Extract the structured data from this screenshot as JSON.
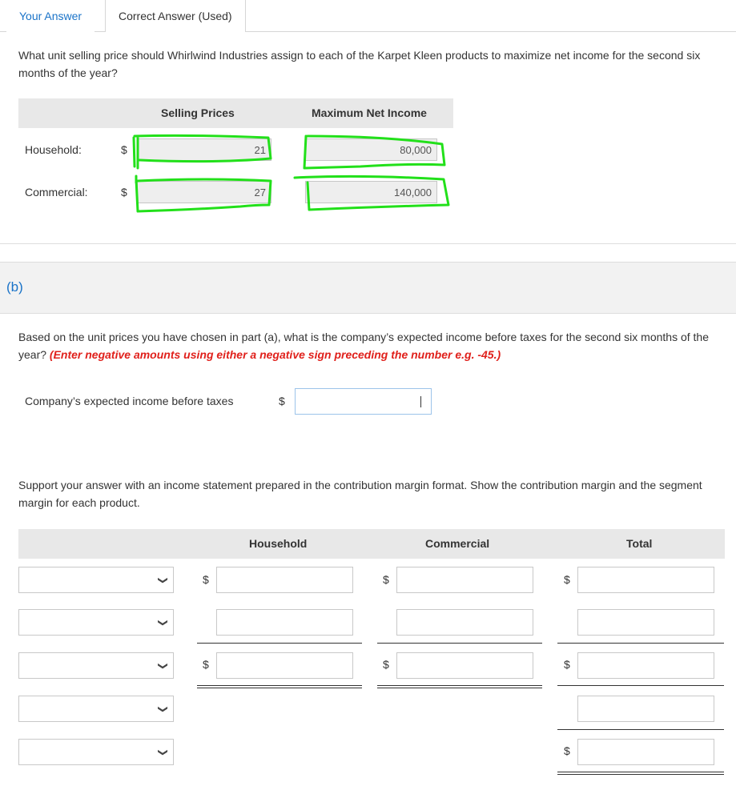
{
  "tabs": [
    {
      "label": "Your Answer",
      "active": true
    },
    {
      "label": "Correct Answer (Used)",
      "active": false
    }
  ],
  "part_a": {
    "question": "What unit selling price should Whirlwind Industries assign to each of the Karpet Kleen products to maximize net income for the second six months of the year?",
    "headers": {
      "selling_prices": "Selling Prices",
      "max_net_income": "Maximum Net Income"
    },
    "rows": [
      {
        "label": "Household:",
        "currency": "$",
        "selling_price": "21",
        "max_net_income": "80,000"
      },
      {
        "label": "Commercial:",
        "currency": "$",
        "selling_price": "27",
        "max_net_income": "140,000"
      }
    ],
    "annotation_color": "#22e01a"
  },
  "part_b": {
    "section_label": "(b)",
    "question": "Based on the unit prices you have chosen in part (a), what is the company’s expected income before taxes for the second six months of the year?",
    "instruction": "(Enter negative amounts using either a negative sign preceding the number e.g. -45.)",
    "income_label": "Company’s expected income before taxes",
    "income_currency": "$",
    "income_value": "",
    "support_text": "Support your answer with an income statement prepared in the contribution margin format. Show the contribution margin and the segment margin for each product.",
    "table_headers": [
      "Household",
      "Commercial",
      "Total"
    ],
    "rows": [
      {
        "select": "",
        "household": {
          "currency": "$",
          "value": ""
        },
        "commercial": {
          "currency": "$",
          "value": ""
        },
        "total": {
          "currency": "$",
          "value": ""
        }
      },
      {
        "select": "",
        "household": {
          "currency": "",
          "value": ""
        },
        "commercial": {
          "currency": "",
          "value": ""
        },
        "total": {
          "currency": "",
          "value": ""
        }
      },
      {
        "select": "",
        "household": {
          "currency": "$",
          "value": ""
        },
        "commercial": {
          "currency": "$",
          "value": ""
        },
        "total": {
          "currency": "$",
          "value": ""
        }
      },
      {
        "select": "",
        "total": {
          "currency": "",
          "value": ""
        }
      },
      {
        "select": "",
        "total": {
          "currency": "$",
          "value": ""
        }
      }
    ]
  },
  "colors": {
    "link_blue": "#1a73c8",
    "instruction_red": "#e0201b",
    "header_gray": "#e8e8e8"
  }
}
